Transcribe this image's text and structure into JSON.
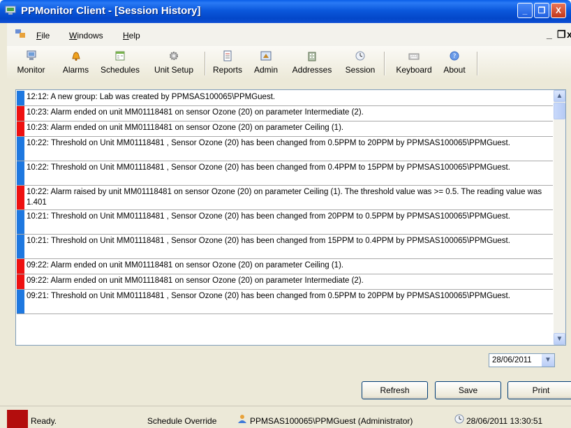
{
  "window": {
    "title": "PPMonitor Client - [Session History]",
    "controls": {
      "minimize": "_",
      "maximize": "❐",
      "close": "X"
    }
  },
  "menu": {
    "items": [
      {
        "label": "File",
        "accel": "F",
        "rest": "ile"
      },
      {
        "label": "Windows",
        "accel": "W",
        "rest": "indows"
      },
      {
        "label": "Help",
        "accel": "H",
        "rest": "elp"
      }
    ],
    "mdi_minimize": "_",
    "mdi_restore": "❐",
    "mdi_close": "x"
  },
  "toolbar": [
    {
      "label": "Monitor",
      "icon": "monitor-icon"
    },
    {
      "label": "Alarms",
      "icon": "alarm-bell-icon"
    },
    {
      "label": "Schedules",
      "icon": "calendar-icon"
    },
    {
      "label": "Unit Setup",
      "icon": "gear-icon"
    },
    {
      "label": "Reports",
      "icon": "report-icon"
    },
    {
      "label": "Admin",
      "icon": "admin-icon"
    },
    {
      "label": "Addresses",
      "icon": "building-icon"
    },
    {
      "label": "Session",
      "icon": "clock-icon"
    },
    {
      "label": "Keyboard",
      "icon": "keyboard-icon"
    },
    {
      "label": "About",
      "icon": "help-icon"
    }
  ],
  "log": [
    {
      "type": "info",
      "text": "12:12: A new group: Lab was created by PPMSAS100065\\PPMGuest."
    },
    {
      "type": "alarm",
      "text": "10:23: Alarm ended on unit MM01118481  on sensor Ozone (20) on parameter Intermediate (2)."
    },
    {
      "type": "alarm",
      "text": "10:23: Alarm ended on unit MM01118481  on sensor Ozone (20) on parameter Ceiling (1)."
    },
    {
      "type": "info",
      "text": "10:22: Threshold on Unit MM01118481 , Sensor Ozone (20) has been changed from 0.5PPM to 20PPM by PPMSAS100065\\PPMGuest."
    },
    {
      "type": "info",
      "text": "10:22: Threshold on Unit MM01118481 , Sensor Ozone (20) has been changed from 0.4PPM to 15PPM by PPMSAS100065\\PPMGuest."
    },
    {
      "type": "alarm",
      "text": "10:22: Alarm raised by unit MM01118481  on sensor Ozone (20) on parameter Ceiling (1). The threshold value was  >= 0.5. The reading value was 1.401"
    },
    {
      "type": "info",
      "text": "10:21: Threshold on Unit MM01118481 , Sensor Ozone (20) has been changed from 20PPM to 0.5PPM by PPMSAS100065\\PPMGuest."
    },
    {
      "type": "info",
      "text": "10:21: Threshold on Unit MM01118481 , Sensor Ozone (20) has been changed from 15PPM to 0.4PPM by PPMSAS100065\\PPMGuest."
    },
    {
      "type": "alarm",
      "text": "09:22: Alarm ended on unit MM01118481  on sensor Ozone (20) on parameter Ceiling (1)."
    },
    {
      "type": "alarm",
      "text": "09:22: Alarm ended on unit MM01118481  on sensor Ozone (20) on parameter Intermediate (2)."
    },
    {
      "type": "info",
      "text": "09:21: Threshold on Unit MM01118481 , Sensor Ozone (20) has been changed from 0.5PPM to 20PPM by PPMSAS100065\\PPMGuest."
    }
  ],
  "colors": {
    "info": "#1e78e0",
    "alarm": "#ee1111",
    "status_swatch": "#b30d0d"
  },
  "date_picker": {
    "value": "28/06/2011"
  },
  "buttons": {
    "refresh": "Refresh",
    "save": "Save",
    "print": "Print"
  },
  "statusbar": {
    "status": "Ready.",
    "schedule": "Schedule Override",
    "user": "PPMSAS100065\\PPMGuest (Administrator)",
    "datetime": "28/06/2011 13:30:51"
  }
}
